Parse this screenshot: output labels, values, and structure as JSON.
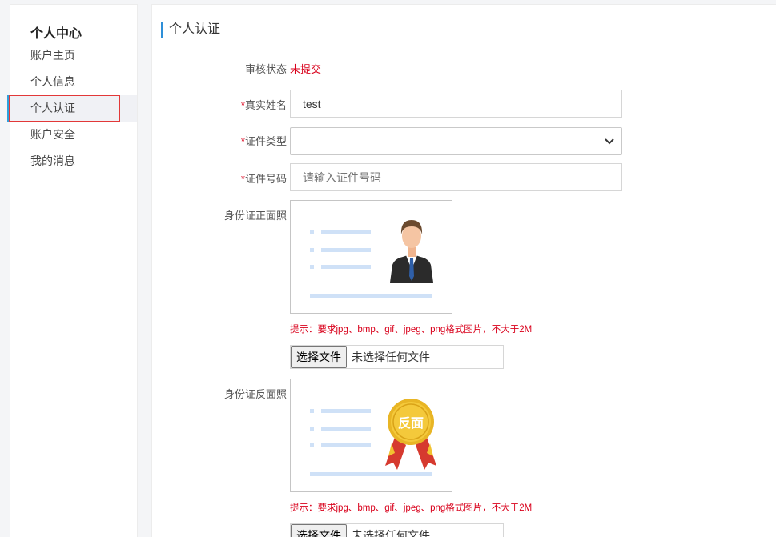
{
  "sidebar": {
    "title": "个人中心",
    "items": [
      {
        "label": "账户主页",
        "active": false
      },
      {
        "label": "个人信息",
        "active": false
      },
      {
        "label": "个人认证",
        "active": true
      },
      {
        "label": "账户安全",
        "active": false
      },
      {
        "label": "我的消息",
        "active": false
      }
    ]
  },
  "main": {
    "section_title": "个人认证",
    "form": {
      "status_label": "审核状态",
      "status_value": "未提交",
      "required_mark": "*",
      "name_label": "真实姓名",
      "name_value": "test",
      "id_type_label": "证件类型",
      "id_type_value": "",
      "id_number_label": "证件号码",
      "id_number_placeholder": "请输入证件号码",
      "front_label": "身份证正面照",
      "back_label": "身份证反面照",
      "back_badge_text": "反面",
      "hint": "提示：要求jpg、bmp、gif、jpeg、png格式图片，不大于2M",
      "file_button": "选择文件",
      "file_none": "未选择任何文件"
    }
  },
  "colors": {
    "accent": "#2e8fd8",
    "required": "#d9001b",
    "highlight_border": "#e23838"
  }
}
